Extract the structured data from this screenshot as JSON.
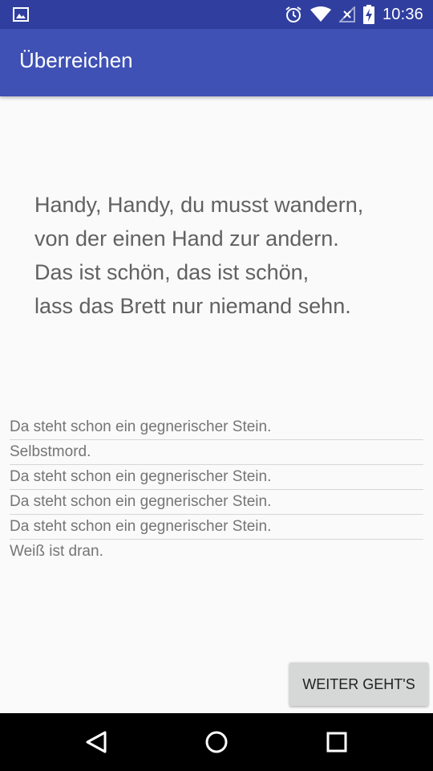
{
  "status_bar": {
    "time": "10:36",
    "icons": [
      "image-icon",
      "alarm-icon",
      "wifi-icon",
      "no-signal-icon",
      "battery-charging-icon"
    ]
  },
  "app_bar": {
    "title": "Überreichen"
  },
  "poem": {
    "lines": [
      "Handy, Handy, du musst wandern,",
      "von der einen Hand zur andern.",
      "Das ist schön, das ist schön,",
      "lass das Brett nur niemand sehn."
    ]
  },
  "messages": [
    "Da steht schon ein gegnerischer Stein.",
    "Selbstmord.",
    "Da steht schon ein gegnerischer Stein.",
    "Da steht schon ein gegnerischer Stein.",
    "Da steht schon ein gegnerischer Stein.",
    "Weiß ist dran."
  ],
  "button": {
    "label": "WEITER GEHT'S"
  },
  "nav_bar": {
    "icons": [
      "back-icon",
      "home-icon",
      "recents-icon"
    ]
  },
  "colors": {
    "status_bar": "#303f9f",
    "app_bar": "#3f51b5",
    "background": "#fafafa",
    "poem_text": "#616161",
    "message_text": "#757575",
    "button_bg": "#d6d7d7"
  }
}
